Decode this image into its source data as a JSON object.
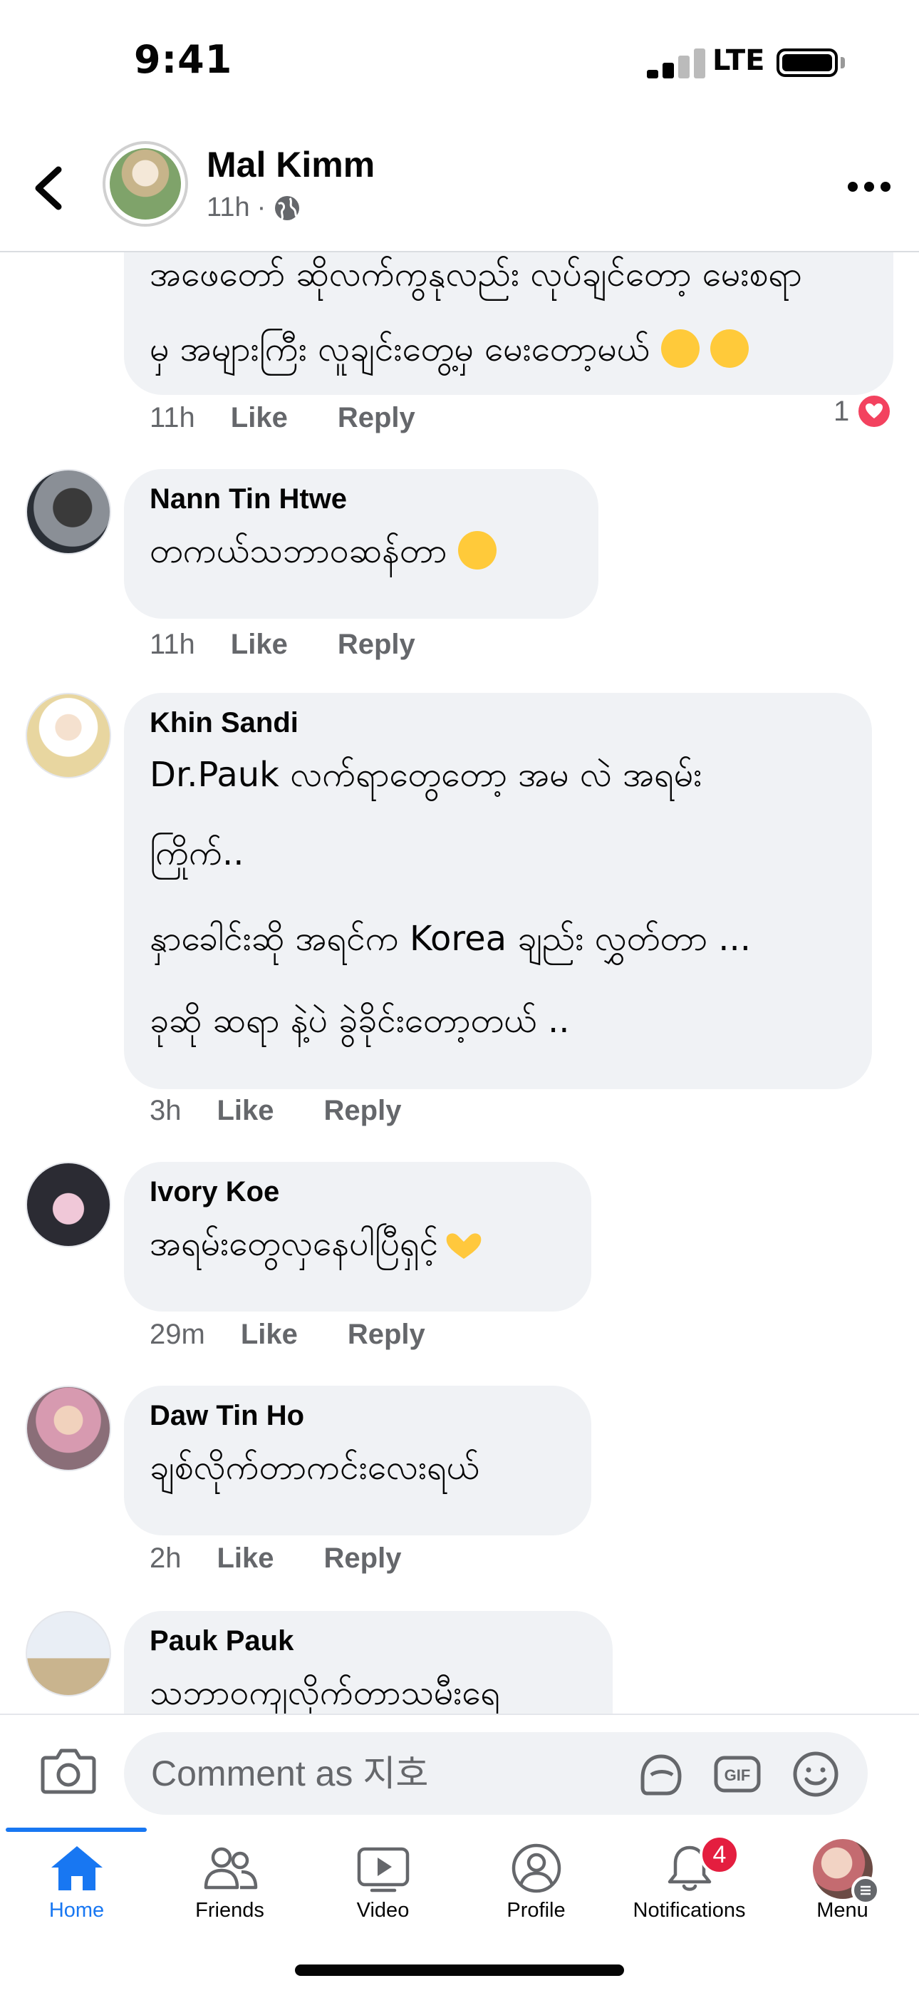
{
  "status_bar": {
    "time": "9:41",
    "network": "LTE"
  },
  "header": {
    "author": "Mal Kimm",
    "time": "11h",
    "separator": "·"
  },
  "comments": [
    {
      "lines": [
        "အဖေတော် ဆိုလက်ကွနုလည်း လုပ်ချင်တော့ မေးစရာ",
        "မှ အများကြီး လူချင်းတွေ့မှ မေးတော့မယ်"
      ],
      "time": "11h",
      "like": "Like",
      "reply": "Reply",
      "reactions": "1"
    },
    {
      "name": "Nann Tin Htwe",
      "lines": [
        "တကယ်သဘာဝဆန်တာ"
      ],
      "time": "11h",
      "like": "Like",
      "reply": "Reply"
    },
    {
      "name": "Khin Sandi",
      "lines": [
        "Dr.Pauk လက်ရာတွေတော့ အမ လဲ အရမ်း",
        "ကြိုက်..",
        "နှာခေါင်းဆို အရင်က Korea ချည်း လွှတ်တာ ...",
        "ခုဆို ဆရာ နဲ့ပဲ ခွဲခိုင်းတော့တယ် .."
      ],
      "time": "3h",
      "like": "Like",
      "reply": "Reply"
    },
    {
      "name": "Ivory Koe",
      "lines": [
        "အရမ်းတွေလှနေပါပြီရှင့်"
      ],
      "time": "29m",
      "like": "Like",
      "reply": "Reply"
    },
    {
      "name": "Daw Tin Ho",
      "lines": [
        "ချစ်လိုက်တာကင်းလေးရယ်"
      ],
      "time": "2h",
      "like": "Like",
      "reply": "Reply"
    },
    {
      "name": "Pauk Pauk",
      "lines": [
        "သဘာဝကျလိုက်တာသမီးရေ"
      ]
    }
  ],
  "comment_input": {
    "placeholder": "Comment as 지호"
  },
  "tabs": [
    {
      "label": "Home",
      "icon": "home-icon"
    },
    {
      "label": "Friends",
      "icon": "friends-icon"
    },
    {
      "label": "Video",
      "icon": "video-icon"
    },
    {
      "label": "Profile",
      "icon": "profile-icon"
    },
    {
      "label": "Notifications",
      "icon": "bell-icon",
      "badge": "4"
    },
    {
      "label": "Menu",
      "icon": "menu-avatar"
    }
  ],
  "colors": {
    "accent": "#1877f2",
    "bubble": "#f0f2f5",
    "muted": "#65676b",
    "badge": "#e41e3f",
    "heart": "#f3425f"
  }
}
